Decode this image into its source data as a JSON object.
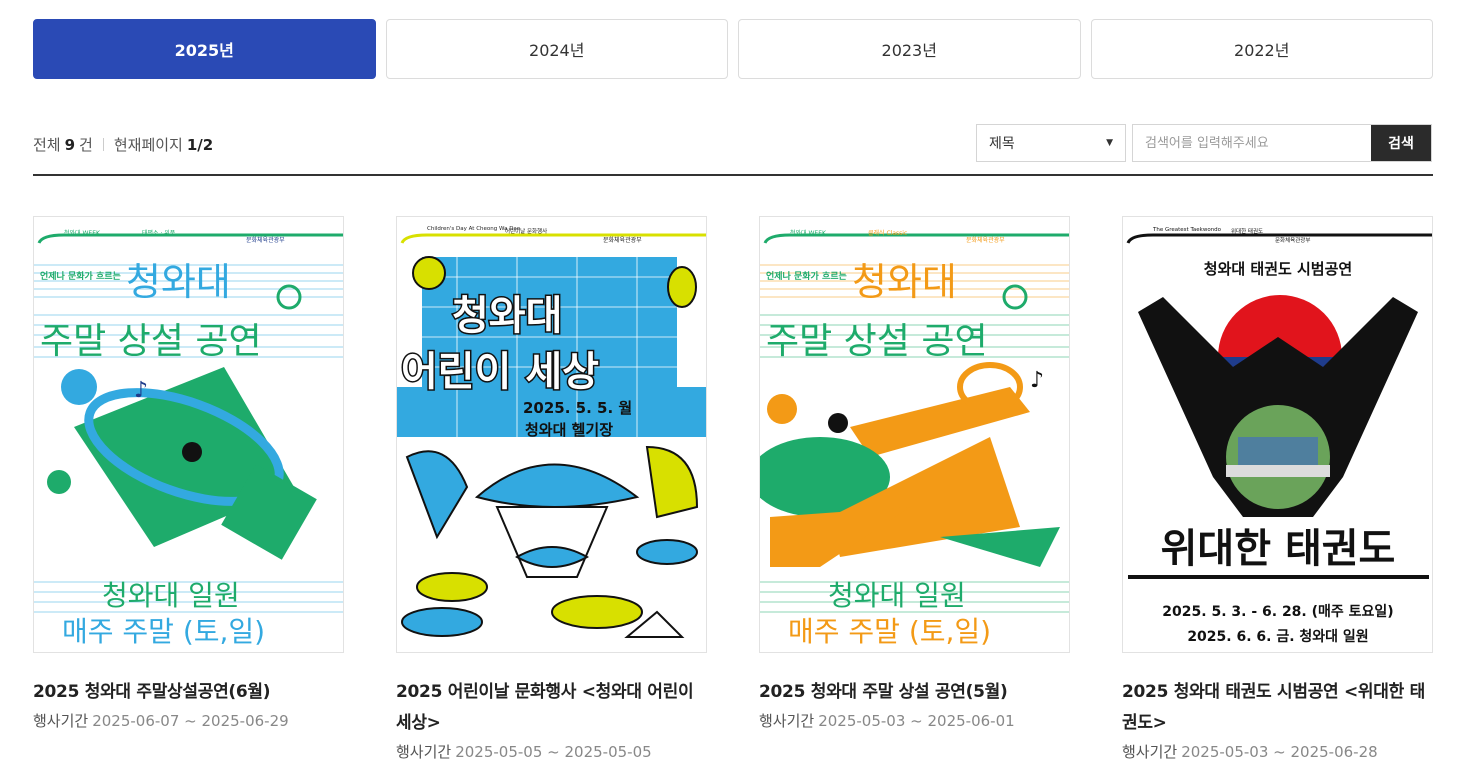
{
  "year_tabs": [
    {
      "label": "2025년",
      "active": true
    },
    {
      "label": "2024년",
      "active": false
    },
    {
      "label": "2023년",
      "active": false
    },
    {
      "label": "2022년",
      "active": false
    }
  ],
  "summary": {
    "total_label": "전체",
    "total_count": "9",
    "total_unit": "건",
    "page_label": "현재페이지",
    "page_value": "1/2"
  },
  "search": {
    "field_selected": "제목",
    "placeholder": "검색어를 입력해주세요",
    "button_label": "검색"
  },
  "period_label": "행사기간",
  "events": [
    {
      "title": "2025 청와대 주말상설공연(6월)",
      "period": "2025-06-07 ~ 2025-06-29",
      "poster": {
        "top_left": "청와대 WEEK",
        "top_mid": "태평소 · 위풍",
        "org": "문화체육관광부",
        "tagline": "언제나 문화가 흐르는",
        "headline": "청와대",
        "subhead": "주말 상설 공연",
        "place": "청와대 일원",
        "schedule": "매주 주말 (토,일)",
        "theme": "green-blue"
      }
    },
    {
      "title": "2025 어린이날 문화행사 <청와대 어린이 세상>",
      "period": "2025-05-05 ~ 2025-05-05",
      "poster": {
        "top_left": "Children's Day At Cheong Wa Dae",
        "top_mid": "어린이날 문화행사",
        "org": "문화체육관광부",
        "headline_1": "청와대",
        "headline_2": "어린이 세상",
        "date": "2025. 5. 5. 월",
        "place": "청와대 헬기장",
        "theme": "kids"
      }
    },
    {
      "title": "2025 청와대 주말 상설 공연(5월)",
      "period": "2025-05-03 ~ 2025-06-01",
      "poster": {
        "top_left": "청와대 WEEK",
        "top_mid": "클래식 Classic",
        "org": "문화체육관광부",
        "tagline": "언제나 문화가 흐르는",
        "headline": "청와대",
        "subhead": "주말 상설 공연",
        "place": "청와대 일원",
        "schedule": "매주 주말 (토,일)",
        "theme": "green-orange"
      }
    },
    {
      "title": "2025 청와대 태권도 시범공연 <위대한 태권도>",
      "period": "2025-05-03 ~ 2025-06-28",
      "poster": {
        "top_left": "The Greatest Taekwondo",
        "top_mid": "위대한 태권도",
        "org": "문화체육관광부",
        "header": "청와대 태권도 시범공연",
        "headline": "위대한 태권도",
        "date_1": "2025. 5. 3. - 6. 28. (매주 토요일)",
        "date_2": "2025. 6. 6. 금. 청와대 일원",
        "theme": "taekwondo"
      }
    }
  ],
  "colors": {
    "tab_active": "#2a4ab5",
    "search_button": "#2b2b2b",
    "poster_green": "#1eab6b",
    "poster_blue": "#33a9e0",
    "poster_orange": "#f39a16",
    "poster_yellow": "#d8e000",
    "poster_red": "#e1141c",
    "poster_navy": "#1f3c8c"
  }
}
